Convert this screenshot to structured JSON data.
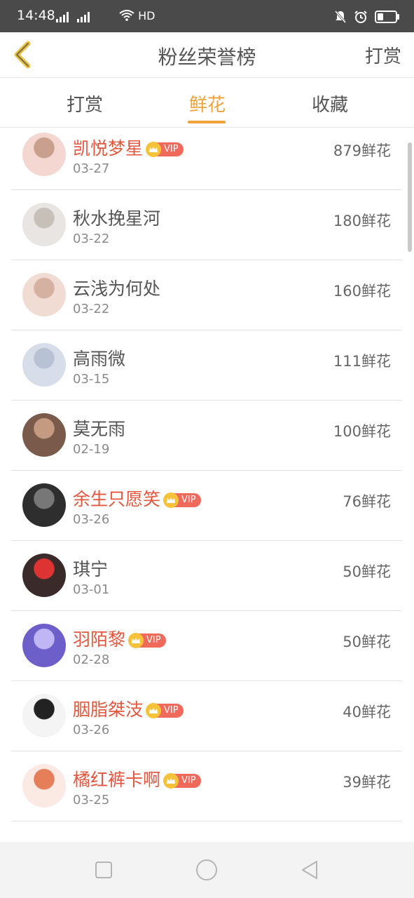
{
  "status": {
    "time": "14:48",
    "network_label": "4G",
    "hd_label": "HD",
    "battery_level": 0.35
  },
  "header": {
    "title": "粉丝荣誉榜",
    "action_label": "打赏"
  },
  "tabs": [
    {
      "label": "打赏",
      "active": false
    },
    {
      "label": "鲜花",
      "active": true
    },
    {
      "label": "收藏",
      "active": false
    }
  ],
  "vip_label": "VIP",
  "fans": [
    {
      "name": "凯悦梦星",
      "date": "03-27",
      "count": "879鲜花",
      "vip": true
    },
    {
      "name": "秋水挽星河",
      "date": "03-22",
      "count": "180鲜花",
      "vip": false
    },
    {
      "name": "云浅为何处",
      "date": "03-22",
      "count": "160鲜花",
      "vip": false
    },
    {
      "name": "高雨微",
      "date": "03-15",
      "count": "111鲜花",
      "vip": false
    },
    {
      "name": "莫无雨",
      "date": "02-19",
      "count": "100鲜花",
      "vip": false
    },
    {
      "name": "余生只愿笑",
      "date": "03-26",
      "count": "76鲜花",
      "vip": true
    },
    {
      "name": "琪宁",
      "date": "03-01",
      "count": "50鲜花",
      "vip": false
    },
    {
      "name": "羽陌黎",
      "date": "02-28",
      "count": "50鲜花",
      "vip": true
    },
    {
      "name": "胭脂桀汥",
      "date": "03-26",
      "count": "40鲜花",
      "vip": true
    },
    {
      "name": "橘红裤卡啊",
      "date": "03-25",
      "count": "39鲜花",
      "vip": true
    }
  ],
  "colors": {
    "accent": "#f2a23a",
    "vip_name": "#e4573f",
    "vip_badge": "#f06a5c",
    "status_bar": "#4a4a4a"
  }
}
